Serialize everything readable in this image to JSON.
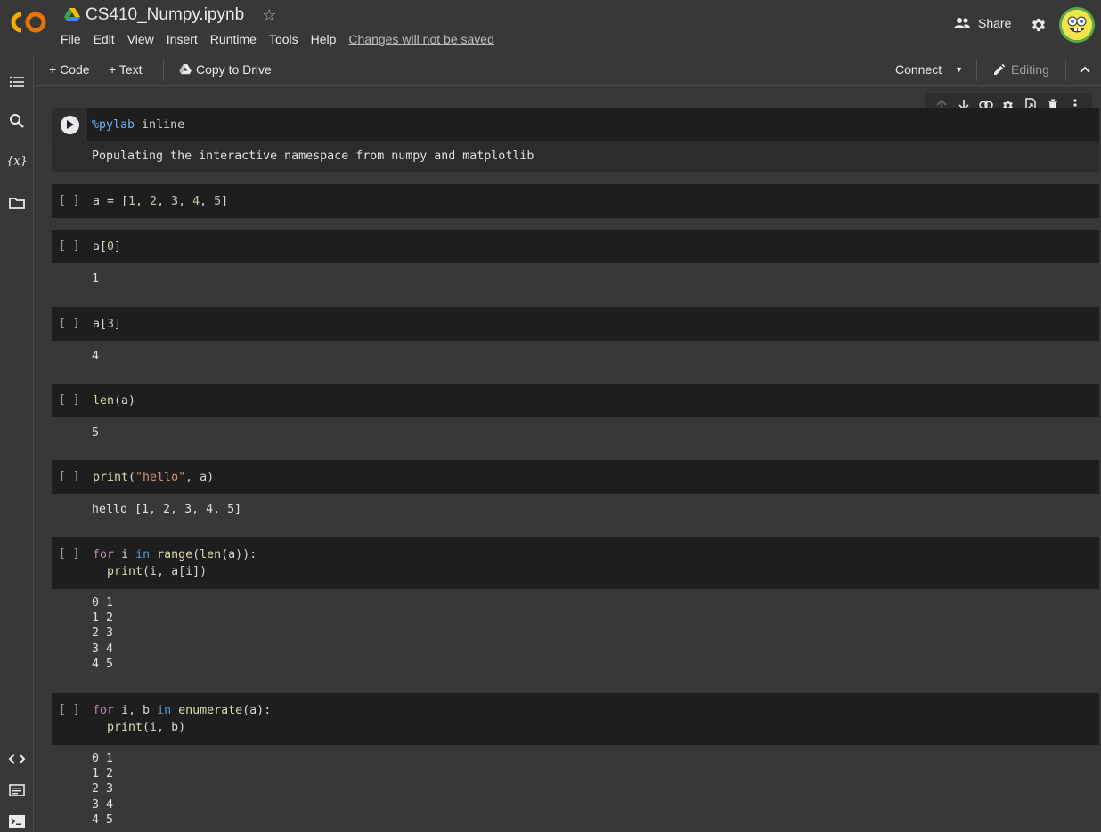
{
  "app": {
    "doc_title": "CS410_Numpy.ipynb",
    "menu": [
      "File",
      "Edit",
      "View",
      "Insert",
      "Runtime",
      "Tools",
      "Help"
    ],
    "unsaved_notice": "Changes will not be saved",
    "share_label": "Share"
  },
  "toolbar": {
    "add_code": "+ Code",
    "add_text": "+ Text",
    "copy_to_drive": "Copy to Drive",
    "connect": "Connect",
    "editing": "Editing"
  },
  "cells": [
    {
      "prompt": "",
      "source": "%pylab inline",
      "output": "Populating the interactive namespace from numpy and matplotlib"
    },
    {
      "prompt": "[ ]",
      "source": "a = [1, 2, 3, 4, 5]",
      "output": ""
    },
    {
      "prompt": "[ ]",
      "source": "a[0]",
      "output": "1"
    },
    {
      "prompt": "[ ]",
      "source": "a[3]",
      "output": "4"
    },
    {
      "prompt": "[ ]",
      "source": "len(a)",
      "output": "5"
    },
    {
      "prompt": "[ ]",
      "source": "print(\"hello\", a)",
      "output": "hello [1, 2, 3, 4, 5]"
    },
    {
      "prompt": "[ ]",
      "source": "for i in range(len(a)):\n  print(i, a[i])",
      "output": "0 1\n1 2\n2 3\n3 4\n4 5"
    },
    {
      "prompt": "[ ]",
      "source": "for i, b in enumerate(a):\n  print(i, b)",
      "output": "0 1\n1 2\n2 3\n3 4\n4 5"
    }
  ],
  "colors": {
    "background": "#383838",
    "code_bg": "#1e1e1e",
    "accent_orange": "#f9ab00"
  }
}
